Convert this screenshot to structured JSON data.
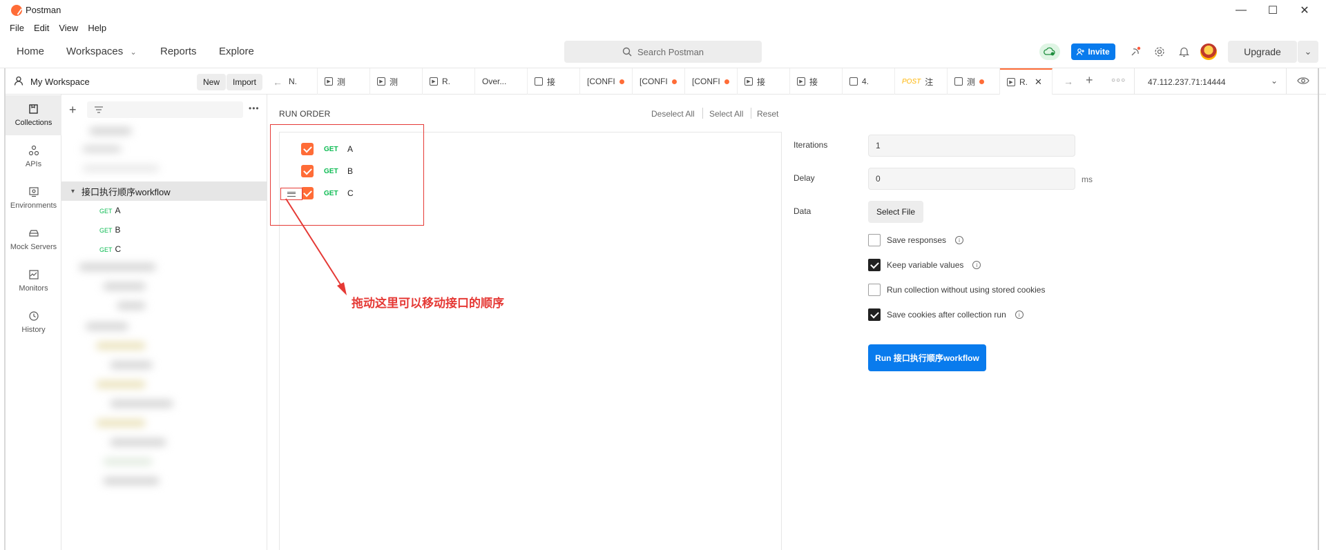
{
  "window": {
    "title": "Postman",
    "minimize": "—",
    "maximize": "☐",
    "close": "✕"
  },
  "menu": [
    "File",
    "Edit",
    "View",
    "Help"
  ],
  "header": {
    "nav": [
      "Home",
      "Workspaces",
      "Reports",
      "Explore"
    ],
    "search_placeholder": "Search Postman",
    "invite_label": "Invite",
    "upgrade_label": "Upgrade"
  },
  "workspace": {
    "name": "My Workspace",
    "new_label": "New",
    "import_label": "Import"
  },
  "rail": [
    {
      "label": "Collections",
      "icon": "collections-icon",
      "active": true
    },
    {
      "label": "APIs",
      "icon": "apis-icon"
    },
    {
      "label": "Environments",
      "icon": "environments-icon"
    },
    {
      "label": "Mock Servers",
      "icon": "mock-servers-icon"
    },
    {
      "label": "Monitors",
      "icon": "monitors-icon"
    },
    {
      "label": "History",
      "icon": "history-icon"
    }
  ],
  "sidebar": {
    "collection_name": "接口执行顺序workflow",
    "requests": [
      {
        "method": "GET",
        "name": "A"
      },
      {
        "method": "GET",
        "name": "B"
      },
      {
        "method": "GET",
        "name": "C"
      }
    ]
  },
  "tabs": [
    {
      "label": "N."
    },
    {
      "label": "测"
    },
    {
      "label": "测"
    },
    {
      "label": "R."
    },
    {
      "label": "Over..."
    },
    {
      "label": "接"
    },
    {
      "label": "[CONFI"
    },
    {
      "label": "[CONFI"
    },
    {
      "label": "[CONFI"
    },
    {
      "label": "接"
    },
    {
      "label": "接"
    },
    {
      "label": "4."
    },
    {
      "label": "POST",
      "suffix": "注"
    },
    {
      "label": "测"
    },
    {
      "label": "R."
    }
  ],
  "environment": "47.112.237.71:14444",
  "runner": {
    "run_order_label": "RUN ORDER",
    "deselect_all": "Deselect All",
    "select_all": "Select All",
    "reset": "Reset",
    "items": [
      {
        "method": "GET",
        "name": "A",
        "checked": true
      },
      {
        "method": "GET",
        "name": "B",
        "checked": true
      },
      {
        "method": "GET",
        "name": "C",
        "checked": true
      }
    ],
    "annotation": "拖动这里可以移动接口的顺序"
  },
  "config": {
    "iterations_label": "Iterations",
    "iterations_value": "1",
    "delay_label": "Delay",
    "delay_value": "0",
    "delay_unit": "ms",
    "data_label": "Data",
    "select_file_label": "Select File",
    "options": [
      {
        "label": "Save responses",
        "checked": false,
        "info": true
      },
      {
        "label": "Keep variable values",
        "checked": true,
        "info": true
      },
      {
        "label": "Run collection without using stored cookies",
        "checked": false,
        "info": false
      },
      {
        "label": "Save cookies after collection run",
        "checked": true,
        "info": true
      }
    ],
    "run_button_label": "Run 接口执行顺序workflow"
  },
  "colors": {
    "accent": "#ff6c37",
    "primary_blue": "#097bed",
    "get_green": "#0cbb52",
    "annotation_red": "#e53935"
  }
}
